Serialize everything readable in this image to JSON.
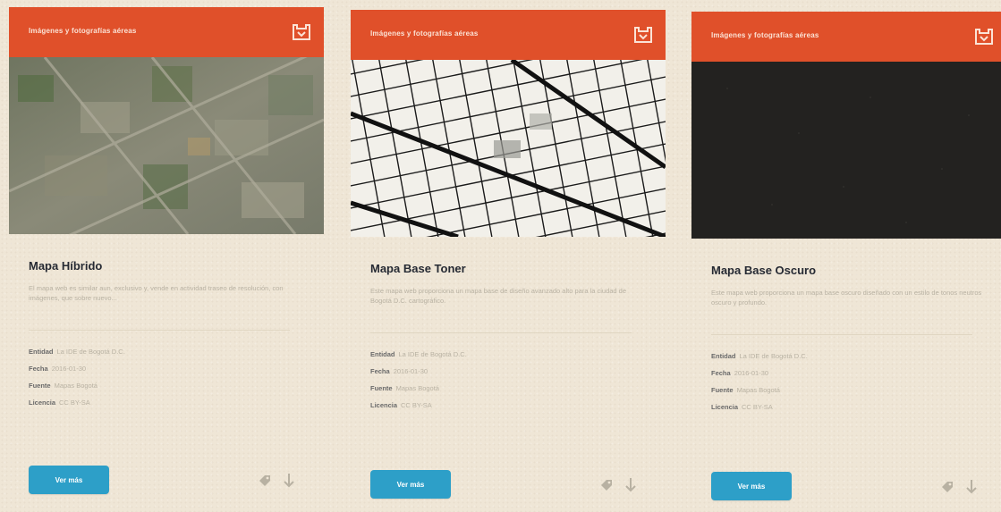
{
  "cards": [
    {
      "category": "Imágenes y fotografías aéreas",
      "title": "Mapa Híbrido",
      "description": "El mapa web es similar aun, exclusivo y, vende en actividad traseo de resolución, con imágenes, que sobre nuevo...",
      "meta": [
        {
          "label": "Entidad",
          "value": "La IDE de Bogotá D.C."
        },
        {
          "label": "Fecha",
          "value": "2016-01-30"
        },
        {
          "label": "Fuente",
          "value": "Mapas Bogotá"
        },
        {
          "label": "Licencia",
          "value": "CC BY-SA"
        }
      ],
      "button": "Ver más",
      "thumb_style": "satellite"
    },
    {
      "category": "Imágenes y fotografías aéreas",
      "title": "Mapa Base Toner",
      "description": "Este mapa web proporciona un mapa base de diseño avanzado alto para la ciudad de Bogotá D.C. cartográfico.",
      "meta": [
        {
          "label": "Entidad",
          "value": "La IDE de Bogotá D.C."
        },
        {
          "label": "Fecha",
          "value": "2016-01-30"
        },
        {
          "label": "Fuente",
          "value": "Mapas Bogotá"
        },
        {
          "label": "Licencia",
          "value": "CC BY-SA"
        }
      ],
      "button": "Ver más",
      "thumb_style": "toner"
    },
    {
      "category": "Imágenes y fotografías aéreas",
      "title": "Mapa Base Oscuro",
      "description": "Este mapa web proporciona un mapa base oscuro diseñado con un estilo de tonos neutros oscuro y profundo.",
      "meta": [
        {
          "label": "Entidad",
          "value": "La IDE de Bogotá D.C."
        },
        {
          "label": "Fecha",
          "value": "2016-01-30"
        },
        {
          "label": "Fuente",
          "value": "Mapas Bogotá"
        },
        {
          "label": "Licencia",
          "value": "CC BY-SA"
        }
      ],
      "button": "Ver más",
      "thumb_style": "dark"
    }
  ],
  "colors": {
    "header": "#e0502a",
    "button": "#2d9fc8",
    "background": "#efe6d6"
  },
  "icons": [
    "logo-icon",
    "tag-icon",
    "download-icon"
  ]
}
